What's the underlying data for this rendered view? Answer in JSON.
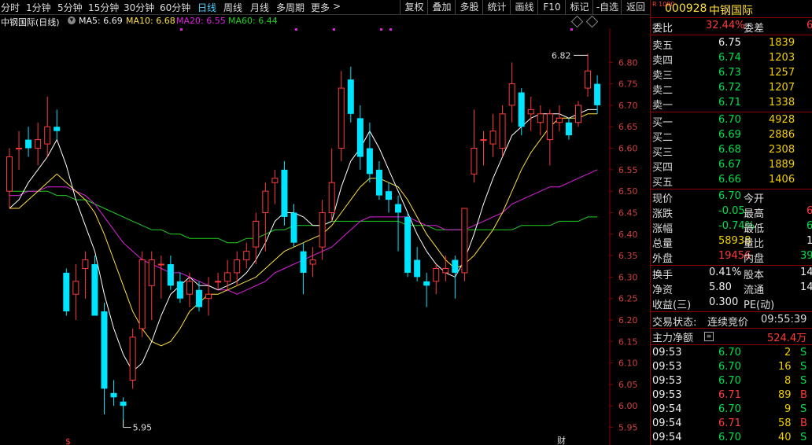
{
  "toolbar": {
    "timeframes": [
      "分时",
      "1分钟",
      "5分钟",
      "15分钟",
      "30分钟",
      "60分钟",
      "日线",
      "周线",
      "月线",
      "多周期",
      "更多"
    ],
    "active_timeframe": "日线",
    "more_arrow": ">",
    "buttons": [
      "复权",
      "叠加",
      "多股",
      "统计",
      "画线",
      "F10",
      "标记",
      "-自选",
      "返回"
    ]
  },
  "chart_header": {
    "title": "中钢国际(日线)",
    "ma5": "MA5: 6.69",
    "ma10": "MA10: 6.68",
    "ma20": "MA20: 6.55",
    "ma60": "MA60: 6.44",
    "high_marker": "6.82",
    "low_marker": "5.95",
    "event_marker": "财",
    "dollar_marker": "$"
  },
  "chart_data": {
    "type": "candlestick",
    "title": "中钢国际(日线)",
    "y_ticks": [
      "6.80",
      "6.75",
      "6.70",
      "6.65",
      "6.60",
      "6.55",
      "6.50",
      "6.45",
      "6.40",
      "6.35",
      "6.30",
      "6.25",
      "6.20",
      "6.15",
      "6.10",
      "6.05",
      "6.00",
      "5.95"
    ],
    "ylim": [
      5.94,
      6.85
    ],
    "grid": false,
    "colors": {
      "up": "#ff3b3b",
      "down": "#00e5ff",
      "ma5": "#ffffff",
      "ma10": "#ffe040",
      "ma20": "#e020e0",
      "ma60": "#20d020"
    },
    "candles": [
      {
        "o": 6.5,
        "h": 6.6,
        "l": 6.46,
        "c": 6.58
      },
      {
        "o": 6.6,
        "h": 6.64,
        "l": 6.55,
        "c": 6.6
      },
      {
        "o": 6.62,
        "h": 6.65,
        "l": 6.58,
        "c": 6.6
      },
      {
        "o": 6.6,
        "h": 6.66,
        "l": 6.56,
        "c": 6.62
      },
      {
        "o": 6.61,
        "h": 6.72,
        "l": 6.58,
        "c": 6.65
      },
      {
        "o": 6.65,
        "h": 6.69,
        "l": 6.62,
        "c": 6.64
      },
      {
        "o": 6.31,
        "h": 6.32,
        "l": 6.21,
        "c": 6.22
      },
      {
        "o": 6.26,
        "h": 6.33,
        "l": 6.2,
        "c": 6.29
      },
      {
        "o": 6.32,
        "h": 6.36,
        "l": 6.25,
        "c": 6.34
      },
      {
        "o": 6.33,
        "h": 6.35,
        "l": 6.22,
        "c": 6.21
      },
      {
        "o": 6.22,
        "h": 6.24,
        "l": 5.98,
        "c": 6.04
      },
      {
        "o": 6.03,
        "h": 6.06,
        "l": 6.0,
        "c": 6.02
      },
      {
        "o": 6.01,
        "h": 6.02,
        "l": 5.95,
        "c": 6.0
      },
      {
        "o": 6.06,
        "h": 6.18,
        "l": 6.04,
        "c": 6.16
      },
      {
        "o": 6.18,
        "h": 6.36,
        "l": 6.16,
        "c": 6.34
      },
      {
        "o": 6.28,
        "h": 6.36,
        "l": 6.2,
        "c": 6.34
      },
      {
        "o": 6.33,
        "h": 6.35,
        "l": 6.25,
        "c": 6.33
      },
      {
        "o": 6.33,
        "h": 6.35,
        "l": 6.27,
        "c": 6.28
      },
      {
        "o": 6.29,
        "h": 6.31,
        "l": 6.24,
        "c": 6.25
      },
      {
        "o": 6.26,
        "h": 6.31,
        "l": 6.23,
        "c": 6.29
      },
      {
        "o": 6.27,
        "h": 6.29,
        "l": 6.22,
        "c": 6.23
      },
      {
        "o": 6.25,
        "h": 6.3,
        "l": 6.21,
        "c": 6.26
      },
      {
        "o": 6.29,
        "h": 6.31,
        "l": 6.27,
        "c": 6.29
      },
      {
        "o": 6.29,
        "h": 6.34,
        "l": 6.27,
        "c": 6.31
      },
      {
        "o": 6.31,
        "h": 6.36,
        "l": 6.28,
        "c": 6.34
      },
      {
        "o": 6.34,
        "h": 6.38,
        "l": 6.32,
        "c": 6.36
      },
      {
        "o": 6.37,
        "h": 6.45,
        "l": 6.33,
        "c": 6.43
      },
      {
        "o": 6.45,
        "h": 6.52,
        "l": 6.36,
        "c": 6.5
      },
      {
        "o": 6.52,
        "h": 6.55,
        "l": 6.47,
        "c": 6.53
      },
      {
        "o": 6.55,
        "h": 6.57,
        "l": 6.42,
        "c": 6.44
      },
      {
        "o": 6.45,
        "h": 6.47,
        "l": 6.37,
        "c": 6.38
      },
      {
        "o": 6.36,
        "h": 6.38,
        "l": 6.26,
        "c": 6.31
      },
      {
        "o": 6.33,
        "h": 6.37,
        "l": 6.3,
        "c": 6.34
      },
      {
        "o": 6.37,
        "h": 6.48,
        "l": 6.34,
        "c": 6.45
      },
      {
        "o": 6.45,
        "h": 6.6,
        "l": 6.43,
        "c": 6.52
      },
      {
        "o": 6.6,
        "h": 6.78,
        "l": 6.57,
        "c": 6.74
      },
      {
        "o": 6.76,
        "h": 6.79,
        "l": 6.66,
        "c": 6.68
      },
      {
        "o": 6.67,
        "h": 6.7,
        "l": 6.55,
        "c": 6.58
      },
      {
        "o": 6.6,
        "h": 6.66,
        "l": 6.52,
        "c": 6.54
      },
      {
        "o": 6.55,
        "h": 6.57,
        "l": 6.48,
        "c": 6.49
      },
      {
        "o": 6.5,
        "h": 6.52,
        "l": 6.45,
        "c": 6.48
      },
      {
        "o": 6.47,
        "h": 6.49,
        "l": 6.36,
        "c": 6.45
      },
      {
        "o": 6.44,
        "h": 6.45,
        "l": 6.3,
        "c": 6.31
      },
      {
        "o": 6.34,
        "h": 6.37,
        "l": 6.29,
        "c": 6.3
      },
      {
        "o": 6.29,
        "h": 6.31,
        "l": 6.23,
        "c": 6.28
      },
      {
        "o": 6.29,
        "h": 6.33,
        "l": 6.26,
        "c": 6.32
      },
      {
        "o": 6.31,
        "h": 6.35,
        "l": 6.29,
        "c": 6.32
      },
      {
        "o": 6.34,
        "h": 6.35,
        "l": 6.25,
        "c": 6.31
      },
      {
        "o": 6.31,
        "h": 6.46,
        "l": 6.29,
        "c": 6.46
      },
      {
        "o": 6.54,
        "h": 6.69,
        "l": 6.52,
        "c": 6.6
      },
      {
        "o": 6.62,
        "h": 6.64,
        "l": 6.56,
        "c": 6.62
      },
      {
        "o": 6.61,
        "h": 6.68,
        "l": 6.58,
        "c": 6.64
      },
      {
        "o": 6.6,
        "h": 6.7,
        "l": 6.58,
        "c": 6.68
      },
      {
        "o": 6.7,
        "h": 6.8,
        "l": 6.66,
        "c": 6.75
      },
      {
        "o": 6.73,
        "h": 6.74,
        "l": 6.63,
        "c": 6.65
      },
      {
        "o": 6.68,
        "h": 6.72,
        "l": 6.64,
        "c": 6.69
      },
      {
        "o": 6.66,
        "h": 6.7,
        "l": 6.63,
        "c": 6.68
      },
      {
        "o": 6.62,
        "h": 6.69,
        "l": 6.56,
        "c": 6.68
      },
      {
        "o": 6.66,
        "h": 6.7,
        "l": 6.64,
        "c": 6.67
      },
      {
        "o": 6.66,
        "h": 6.67,
        "l": 6.62,
        "c": 6.63
      },
      {
        "o": 6.66,
        "h": 6.71,
        "l": 6.65,
        "c": 6.7
      },
      {
        "o": 6.74,
        "h": 6.82,
        "l": 6.72,
        "c": 6.78
      },
      {
        "o": 6.75,
        "h": 6.77,
        "l": 6.68,
        "c": 6.7
      }
    ],
    "ma5": [
      6.46,
      6.48,
      6.52,
      6.55,
      6.58,
      6.62,
      6.56,
      6.48,
      6.42,
      6.36,
      6.26,
      6.18,
      6.12,
      6.08,
      6.1,
      6.15,
      6.21,
      6.26,
      6.28,
      6.3,
      6.28,
      6.28,
      6.27,
      6.28,
      6.29,
      6.31,
      6.34,
      6.38,
      6.43,
      6.45,
      6.45,
      6.44,
      6.42,
      6.42,
      6.43,
      6.51,
      6.57,
      6.6,
      6.64,
      6.6,
      6.55,
      6.5,
      6.45,
      6.4,
      6.36,
      6.33,
      6.31,
      6.3,
      6.34,
      6.4,
      6.47,
      6.53,
      6.58,
      6.63,
      6.65,
      6.67,
      6.68,
      6.68,
      6.68,
      6.67,
      6.68,
      6.69,
      6.69
    ],
    "ma10": [
      6.46,
      6.46,
      6.48,
      6.5,
      6.52,
      6.54,
      6.52,
      6.5,
      6.48,
      6.45,
      6.4,
      6.34,
      6.28,
      6.22,
      6.18,
      6.15,
      6.14,
      6.15,
      6.18,
      6.22,
      6.24,
      6.26,
      6.26,
      6.27,
      6.28,
      6.29,
      6.3,
      6.32,
      6.34,
      6.36,
      6.37,
      6.38,
      6.39,
      6.4,
      6.42,
      6.45,
      6.48,
      6.51,
      6.53,
      6.53,
      6.52,
      6.51,
      6.48,
      6.44,
      6.4,
      6.37,
      6.34,
      6.32,
      6.33,
      6.35,
      6.38,
      6.41,
      6.45,
      6.5,
      6.55,
      6.59,
      6.62,
      6.65,
      6.67,
      6.67,
      6.67,
      6.68,
      6.68
    ],
    "ma20": [
      6.49,
      6.49,
      6.5,
      6.5,
      6.51,
      6.51,
      6.51,
      6.5,
      6.49,
      6.47,
      6.44,
      6.41,
      6.38,
      6.36,
      6.34,
      6.33,
      6.32,
      6.31,
      6.31,
      6.3,
      6.29,
      6.28,
      6.27,
      6.27,
      6.26,
      6.27,
      6.28,
      6.29,
      6.31,
      6.32,
      6.33,
      6.34,
      6.35,
      6.36,
      6.37,
      6.39,
      6.41,
      6.43,
      6.44,
      6.44,
      6.44,
      6.44,
      6.44,
      6.43,
      6.42,
      6.42,
      6.41,
      6.41,
      6.41,
      6.42,
      6.43,
      6.44,
      6.45,
      6.47,
      6.48,
      6.49,
      6.5,
      6.51,
      6.51,
      6.52,
      6.53,
      6.54,
      6.55
    ],
    "ma60": [
      6.5,
      6.5,
      6.5,
      6.5,
      6.5,
      6.49,
      6.49,
      6.48,
      6.48,
      6.47,
      6.46,
      6.45,
      6.44,
      6.43,
      6.42,
      6.41,
      6.41,
      6.4,
      6.4,
      6.39,
      6.39,
      6.39,
      6.39,
      6.38,
      6.38,
      6.39,
      6.39,
      6.4,
      6.41,
      6.41,
      6.42,
      6.42,
      6.42,
      6.42,
      6.43,
      6.43,
      6.43,
      6.43,
      6.43,
      6.43,
      6.43,
      6.43,
      6.42,
      6.42,
      6.42,
      6.41,
      6.41,
      6.41,
      6.41,
      6.41,
      6.41,
      6.41,
      6.41,
      6.41,
      6.42,
      6.42,
      6.42,
      6.42,
      6.43,
      6.43,
      6.43,
      6.44,
      6.44
    ],
    "annotations": {
      "high": 6.82,
      "low": 5.95
    }
  },
  "panel": {
    "code": "000928",
    "name": "中钢国际",
    "badge": "R 1000",
    "weibi_label": "委比",
    "weibi_value": "32.44%",
    "weicha_label": "委差",
    "weicha_value": "6",
    "asks": [
      {
        "label": "卖五",
        "price": "6.75",
        "vol": "1839"
      },
      {
        "label": "卖四",
        "price": "6.74",
        "vol": "1203"
      },
      {
        "label": "卖三",
        "price": "6.73",
        "vol": "1257"
      },
      {
        "label": "卖二",
        "price": "6.72",
        "vol": "1207"
      },
      {
        "label": "卖一",
        "price": "6.71",
        "vol": "1338"
      }
    ],
    "bids": [
      {
        "label": "买一",
        "price": "6.70",
        "vol": "4928"
      },
      {
        "label": "买二",
        "price": "6.69",
        "vol": "2886"
      },
      {
        "label": "买三",
        "price": "6.68",
        "vol": "2308"
      },
      {
        "label": "买四",
        "price": "6.67",
        "vol": "1889"
      },
      {
        "label": "买五",
        "price": "6.66",
        "vol": "1406"
      }
    ],
    "stats": [
      {
        "l1": "现价",
        "v1": "6.70",
        "l2": "今开",
        "v2": ""
      },
      {
        "l1": "涨跌",
        "v1": "-0.05",
        "l2": "最高",
        "v2": "6"
      },
      {
        "l1": "涨幅",
        "v1": "-0.74%",
        "l2": "最低",
        "v2": "6"
      },
      {
        "l1": "总量",
        "v1": "58938",
        "l2": "量比",
        "v2": "1"
      },
      {
        "l1": "外盘",
        "v1": "19456",
        "l2": "内盘",
        "v2": "39"
      }
    ],
    "fund": [
      {
        "l1": "换手",
        "v1": "0.41%",
        "l2": "股本",
        "v2": "14"
      },
      {
        "l1": "净资",
        "v1": "5.80",
        "l2": "流通",
        "v2": "14"
      },
      {
        "l1": "收益(三)",
        "v1": "0.300",
        "l2": "PE(动)",
        "v2": ""
      }
    ],
    "trade_status_label": "交易状态:",
    "trade_status_value": "连续竞价",
    "trade_status_time": "09:55:39",
    "main_net_label": "主力净额",
    "main_net_value": "524.4万",
    "ticks": [
      {
        "time": "09:53",
        "price": "6.70",
        "vol": "2",
        "side": "S"
      },
      {
        "time": "09:53",
        "price": "6.70",
        "vol": "16",
        "side": "S"
      },
      {
        "time": "09:53",
        "price": "6.70",
        "vol": "8",
        "side": "S"
      },
      {
        "time": "09:53",
        "price": "6.71",
        "vol": "89",
        "side": "B"
      },
      {
        "time": "09:54",
        "price": "6.70",
        "vol": "9",
        "side": "S"
      },
      {
        "time": "09:54",
        "price": "6.71",
        "vol": "58",
        "side": "B"
      },
      {
        "time": "09:54",
        "price": "6.70",
        "vol": "40",
        "side": "S"
      }
    ]
  }
}
